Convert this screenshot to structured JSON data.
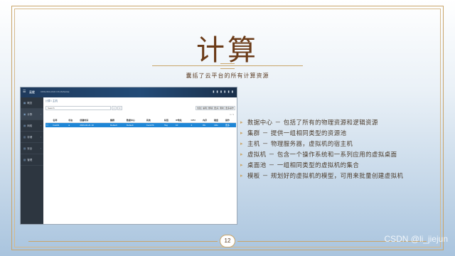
{
  "slide": {
    "title": "计算",
    "subtitle": "囊括了云平台的所有计算资源",
    "page_number": "12",
    "watermark": "CSDN @li_jiejun"
  },
  "screenshot": {
    "brand": "云宏",
    "url": "CNW-WCLOUD OS MANAGE",
    "header_icons": "▮ ▮ ▮ ▮ ▮ ▮",
    "breadcrumb": "计算 / 主机",
    "search_placeholder": "Search",
    "toolbar": [
      "创建",
      "编辑",
      "删除",
      "更多",
      "刷新",
      "更多操作"
    ],
    "pager_text": "1 / 1",
    "sidebar": [
      {
        "label": "概览",
        "icon": "▦"
      },
      {
        "label": "计算",
        "icon": "▣"
      },
      {
        "label": "网络",
        "icon": "▤"
      },
      {
        "label": "存储",
        "icon": "▥"
      },
      {
        "label": "安全",
        "icon": "▧"
      },
      {
        "label": "管理",
        "icon": "▨"
      }
    ],
    "table": {
      "headers": [
        "",
        "名称",
        "状态",
        "创建时间",
        "集群",
        "数据中心",
        "系统",
        "标签",
        "IP地址",
        "CPU",
        "内存",
        "磁盘",
        "操作"
      ],
      "rows": [
        [
          "☐",
          "host01",
          "●",
          "2019-04-21 10",
          "Default",
          "Default",
          "CentOS",
          "Tag",
          "10",
          "4",
          "8G",
          "40G",
          "更多"
        ]
      ]
    }
  },
  "bullets": [
    "数据中心 － 包括了所有的物理资源和逻辑资源",
    "集群 － 提供一组相同类型的资源池",
    "主机 － 物理服务器，虚拟机的宿主机",
    "虚拟机 － 包含一个操作系统和一系列应用的虚拟桌面",
    "桌面池 － 一组相同类型的虚拟机的集合",
    "模板 － 规划好的虚拟机的模型，可用来批量创建虚拟机"
  ]
}
